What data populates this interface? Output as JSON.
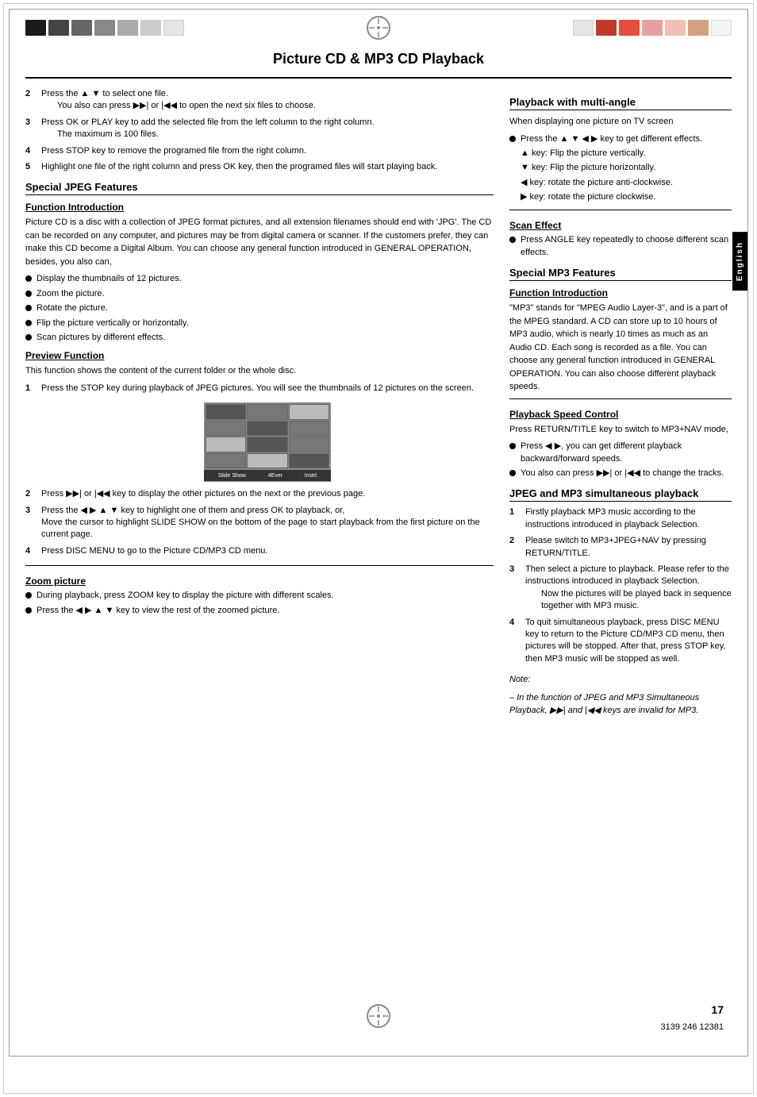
{
  "page": {
    "title": "Picture CD & MP3 CD Playback",
    "page_number": "17",
    "footer_code": "3139 246 12381"
  },
  "top_bar": {
    "left_squares": [
      "black",
      "gray1",
      "gray2",
      "gray3",
      "gray4",
      "gray5"
    ],
    "right_squares": [
      "red1",
      "red2",
      "pink",
      "peach",
      "tan",
      "white"
    ]
  },
  "english_tab": "English",
  "left_column": {
    "intro_items": [
      {
        "num": "2",
        "text": "Press the ▲ ▼ to select one file.",
        "sub": "You also can press ▶▶| or |◀◀ to open the next six files to choose."
      },
      {
        "num": "3",
        "text": "Press OK or PLAY key to add the selected file from the left column to the right column.",
        "sub": "The maximum is 100 files."
      },
      {
        "num": "4",
        "text": "Press STOP key to remove the programed file from the right column."
      },
      {
        "num": "5",
        "text": "Highlight one file of the right column and press OK key, then the programed files will start playing back."
      }
    ],
    "special_jpeg": {
      "title": "Special JPEG Features",
      "function_intro": {
        "title": "Function Introduction",
        "body": "Picture CD is a disc with a collection of JPEG format pictures, and all extension filenames should end with 'JPG'. The CD can be recorded on any computer, and pictures may be from digital camera or scanner. If the customers prefer, they can make this CD become a Digital Album. You can choose any general function introduced in GENERAL OPERATION, besides, you also can,"
      },
      "bullet_items": [
        "Display the thumbnails of 12 pictures.",
        "Zoom the picture.",
        "Rotate the picture.",
        "Flip the picture vertically or horizontally.",
        "Scan pictures by different effects."
      ],
      "preview_function": {
        "title": "Preview Function",
        "body": "This function shows the content of the current folder or the whole disc.",
        "steps": [
          {
            "num": "1",
            "text": "Press the STOP key during playback of JPEG pictures. You will see the thumbnails of 12 pictures on the screen."
          },
          {
            "num": "2",
            "text": "Press ▶▶| or |◀◀ key to display the other pictures on the next or the previous page."
          },
          {
            "num": "3",
            "text": "Press the ◀ ▶ ▲ ▼ key to highlight one of them and press OK to playback, or, Move the cursor to highlight SLIDE SHOW on the bottom of the page to start playback from the first picture on the current page."
          },
          {
            "num": "4",
            "text": "Press DISC MENU to go to the Picture CD/MP3 CD menu."
          }
        ]
      },
      "zoom_picture": {
        "title": "Zoom picture",
        "bullets": [
          "During playback, press ZOOM key to display the picture with different scales.",
          "Press the ◀ ▶ ▲ ▼ key to view the rest of the zoomed picture."
        ]
      }
    }
  },
  "right_column": {
    "playback_multi_angle": {
      "title": "Playback with multi-angle",
      "intro": "When displaying one picture on TV screen",
      "bullets": [
        "Press the ▲ ▼ ◀ ▶ key to get different effects.",
        "▲ key: Flip the picture vertically.",
        "▼ key: Flip the picture horizontally.",
        "◀ key: rotate the picture anti-clockwise.",
        "▶ key: rotate the picture clockwise."
      ]
    },
    "scan_effect": {
      "title": "Scan Effect",
      "bullets": [
        "Press ANGLE key repeatedly to choose different scan effects."
      ]
    },
    "special_mp3": {
      "title": "Special MP3 Features",
      "function_intro": {
        "title": "Function Introduction",
        "body": "\"MP3\" stands for \"MPEG Audio Layer-3\", and is a part of the MPEG standard. A CD can store up to 10 hours of MP3 audio, which is nearly 10 times as much as an Audio CD. Each song is recorded as a file. You can choose any general function introduced in GENERAL OPERATION. You can also choose different playback speeds."
      }
    },
    "playback_speed": {
      "title": "Playback Speed Control",
      "intro": "Press RETURN/TITLE key to switch to MP3+NAV mode,",
      "bullets": [
        "Press ◀ ▶, you can get different playback backward/forward speeds.",
        "You also can press ▶▶| or |◀◀ to change the tracks."
      ]
    },
    "jpeg_mp3_simultaneous": {
      "title": "JPEG and MP3 simultaneous playback",
      "steps": [
        {
          "num": "1",
          "text": "Firstly playback MP3 music according to the instructions introduced in playback Selection."
        },
        {
          "num": "2",
          "text": "Please switch to MP3+JPEG+NAV by pressing RETURN/TITLE."
        },
        {
          "num": "3",
          "text": "Then select a picture to playback. Please refer to the instructions introduced in playback Selection. Now the pictures will be played back in sequence together with MP3 music."
        },
        {
          "num": "4",
          "text": "To quit simultaneous playback, press DISC MENU key to return to the Picture CD/MP3 CD menu, then pictures will be stopped. After that, press STOP key, then MP3 music will be stopped as well."
        }
      ],
      "note": {
        "label": "Note:",
        "text": "– In the function of JPEG and MP3 Simultaneous Playback, ▶▶| and |◀◀ keys are invalid for MP3."
      }
    }
  }
}
